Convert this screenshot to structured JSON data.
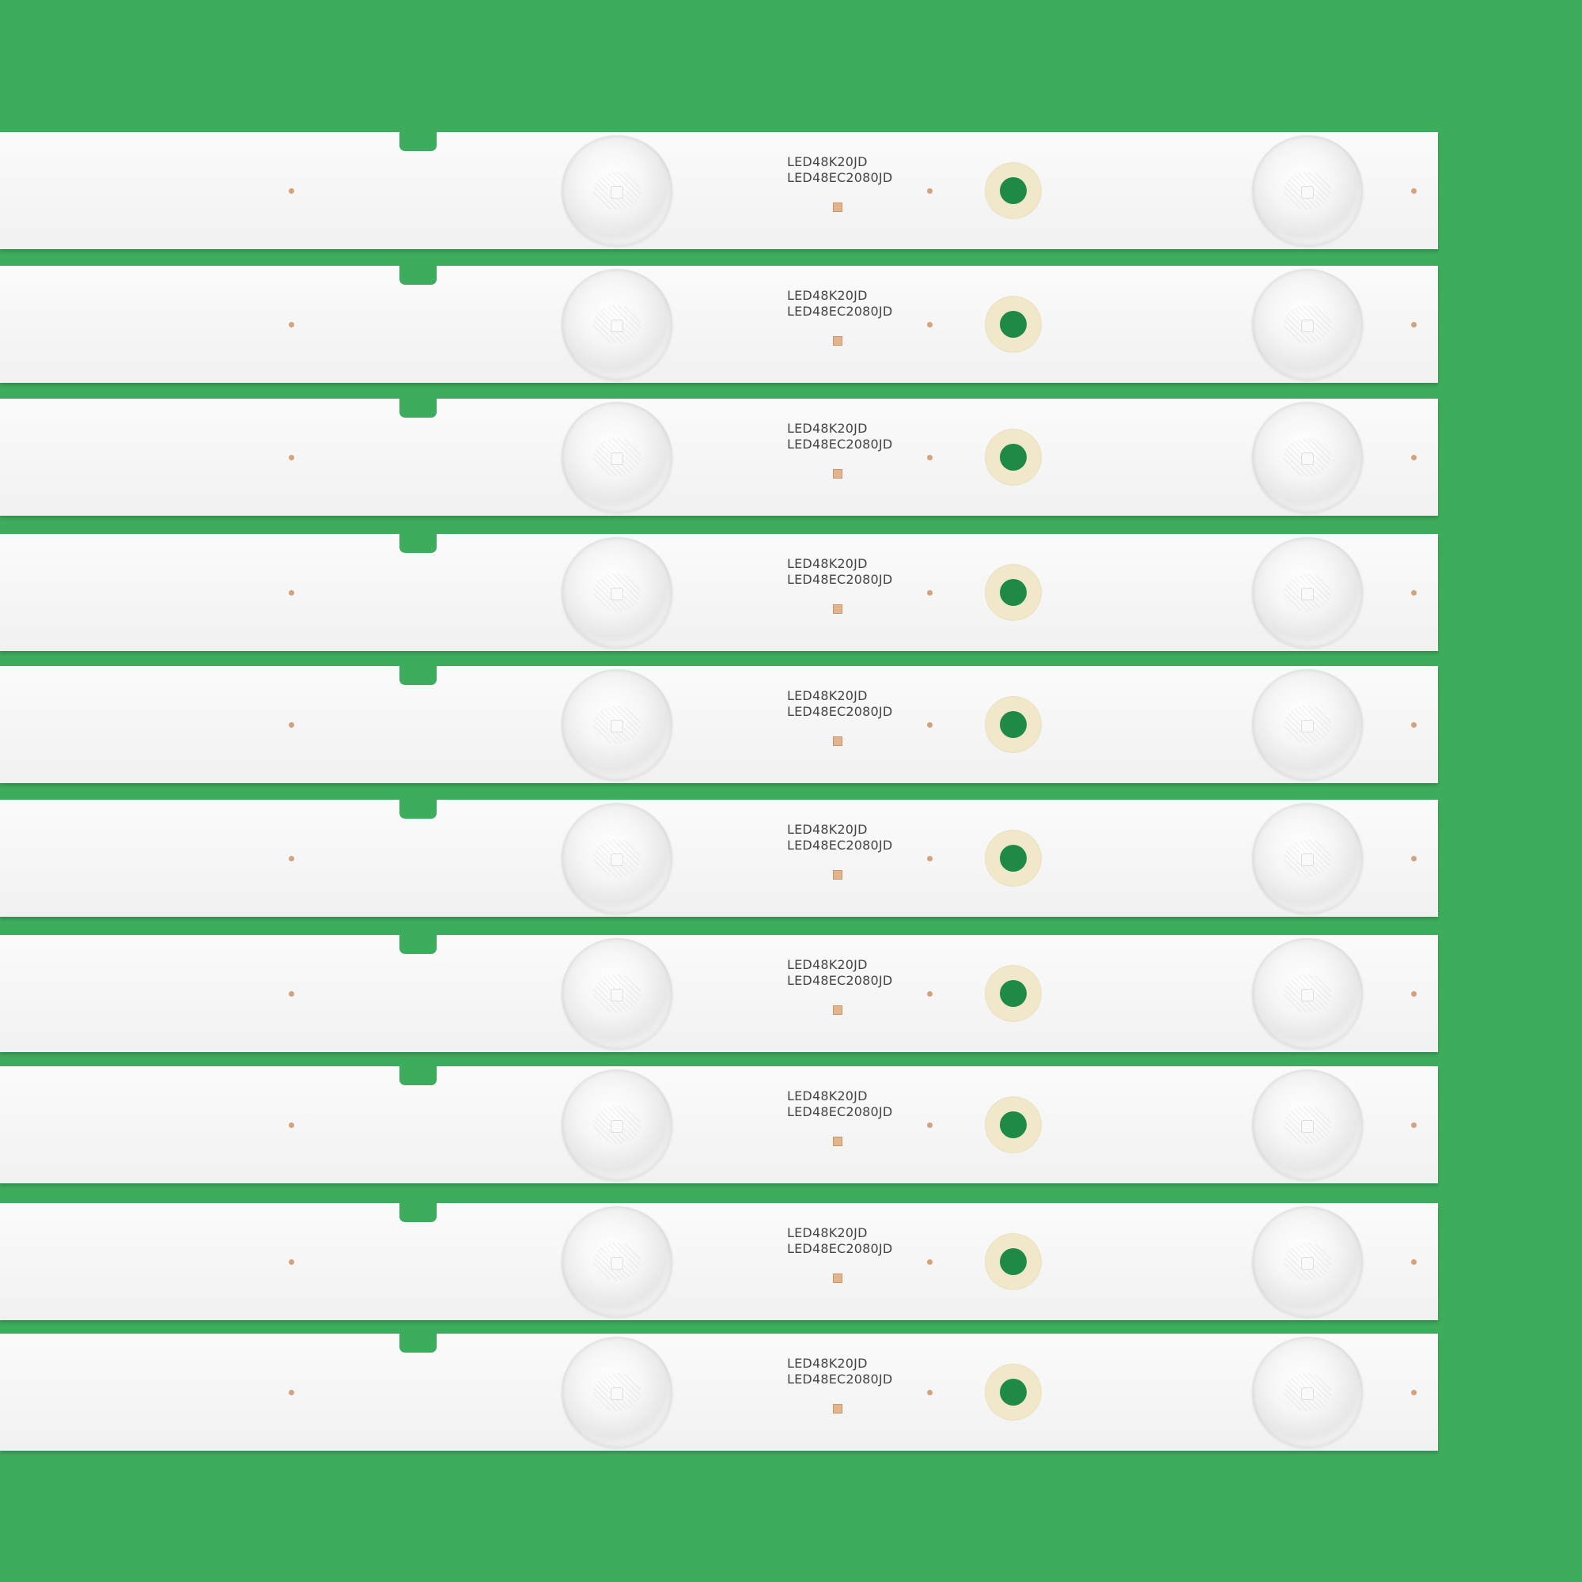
{
  "scene": {
    "background_color": "#3dac5d",
    "strip_color": "#f7f7f7",
    "strips": [
      {
        "line1": "LED48K20JD",
        "line2": "LED48EC2080JD"
      },
      {
        "line1": "LED48K20JD",
        "line2": "LED48EC2080JD"
      },
      {
        "line1": "LED48K20JD",
        "line2": "LED48EC2080JD"
      },
      {
        "line1": "LED48K20JD",
        "line2": "LED48EC2080JD"
      },
      {
        "line1": "LED48K20JD",
        "line2": "LED48EC2080JD"
      },
      {
        "line1": "LED48K20JD",
        "line2": "LED48EC2080JD"
      },
      {
        "line1": "LED48K20JD",
        "line2": "LED48EC2080JD"
      },
      {
        "line1": "LED48K20JD",
        "line2": "LED48EC2080JD"
      },
      {
        "line1": "LED48K20JD",
        "line2": "LED48EC2080JD"
      },
      {
        "line1": "LED48K20JD",
        "line2": "LED48EC2080JD"
      }
    ]
  }
}
